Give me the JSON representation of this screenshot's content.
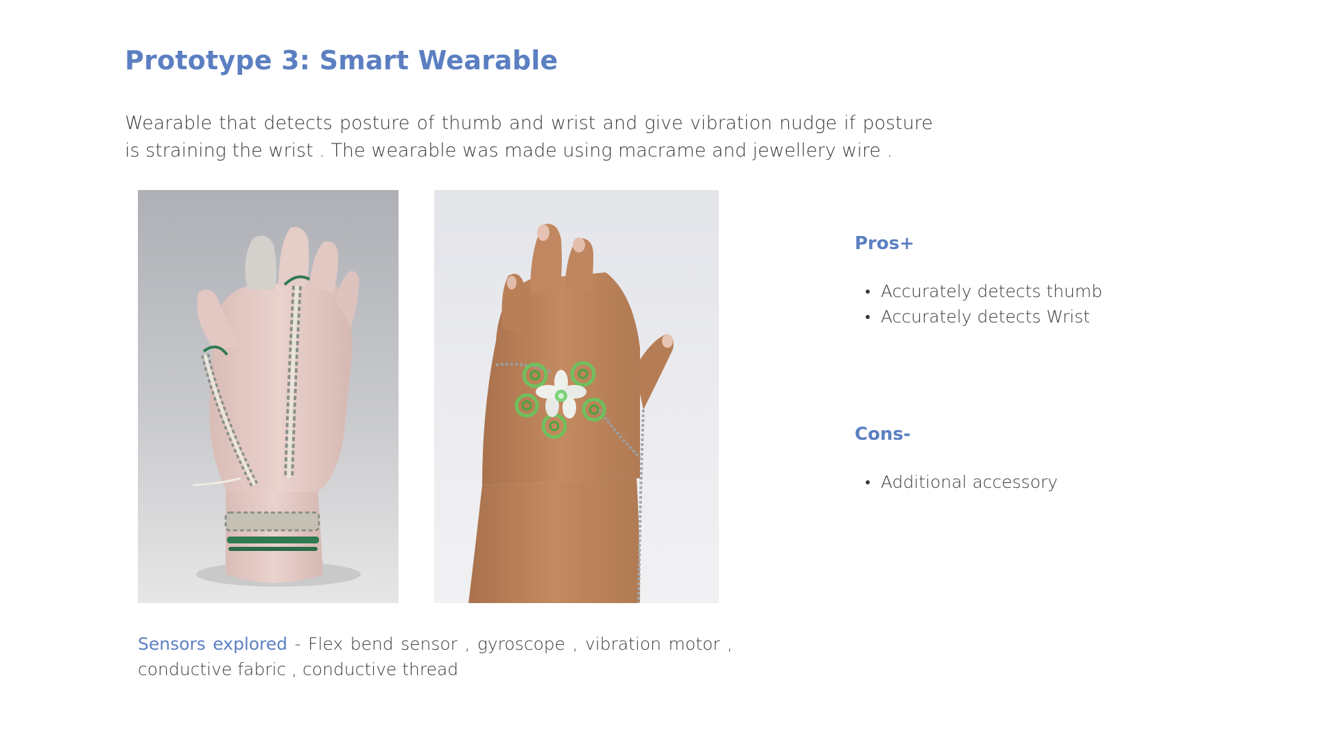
{
  "slide": {
    "title": "Prototype 3: Smart Wearable",
    "description": "Wearable that detects posture of thumb and wrist and give vibration nudge if posture is straining the wrist . The wearable was made using macrame and jewellery wire ."
  },
  "photos": [
    {
      "subject": "clay hand model wearing macrame wrist strap"
    },
    {
      "subject": "hand wearing green wire flower ring bracelet"
    }
  ],
  "sensors": {
    "label": "Sensors explored",
    "text": " - Flex bend sensor , gyroscope , vibration motor , conductive fabric , conductive thread"
  },
  "pros": {
    "heading": "Pros+",
    "items": [
      "Accurately detects thumb",
      "Accurately detects Wrist"
    ]
  },
  "cons": {
    "heading": "Cons-",
    "items": [
      "Additional accessory"
    ]
  },
  "colors": {
    "accent": "#5b7fc1",
    "body_text": "#3a3a3a",
    "background": "#ffffff"
  }
}
